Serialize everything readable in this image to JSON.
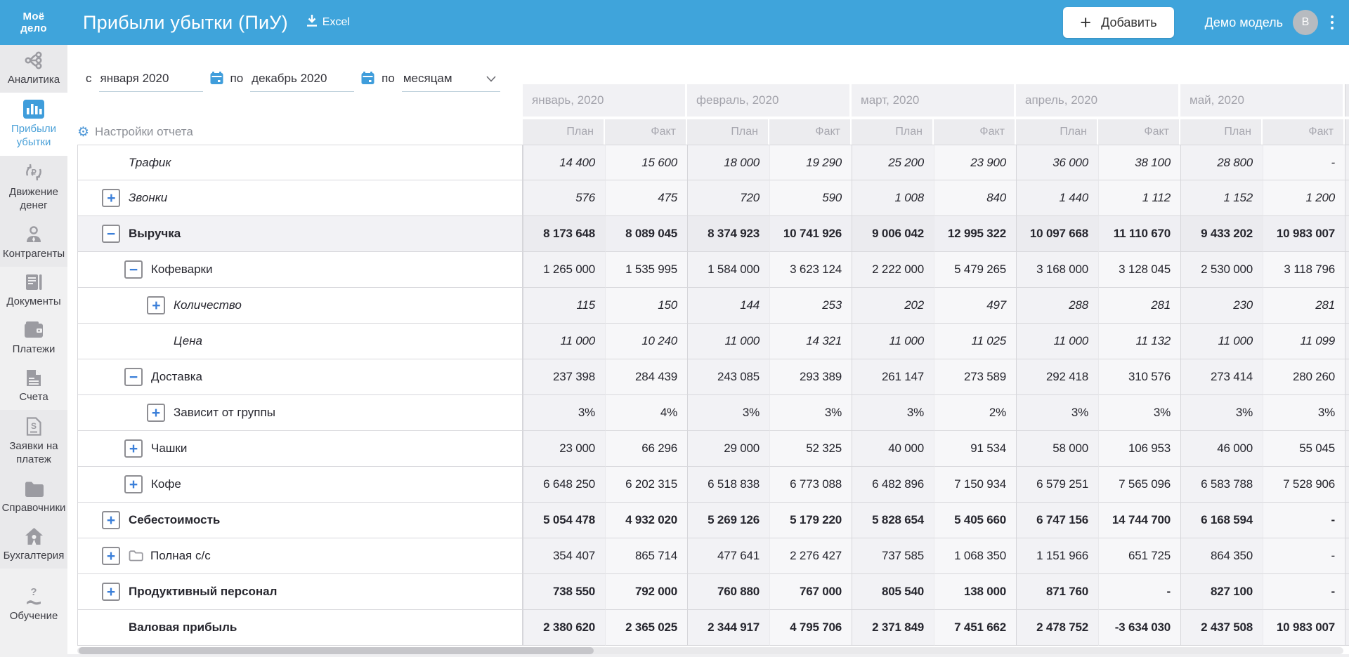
{
  "header": {
    "logo_lines": [
      "Моё",
      "дело"
    ],
    "title": "Прибыли убытки (ПиУ)",
    "excel_label": "Excel",
    "add_button_label": "Добавить",
    "add_plus": "+",
    "account_label": "Демо модель",
    "avatar_letter": "B"
  },
  "colors": {
    "header_blue": "#3fa4db",
    "active_item_blue": "#4ba1d8",
    "toggle_plus_blue": "#3b7fd9",
    "accent_gear_blue": "#4a95d6",
    "avatar_gray": "#b7bbc0"
  },
  "sidebar": {
    "items": [
      {
        "label": "Аналитика",
        "lines": [
          "Аналитика"
        ],
        "icon": "analytics-icon",
        "active": false,
        "tone": "dark"
      },
      {
        "label": "Прибыли убытки",
        "lines": [
          "Прибыли",
          "убытки"
        ],
        "icon": "profit-loss-icon",
        "active": true,
        "tone": "light"
      },
      {
        "label": "Движение денег",
        "lines": [
          "Движение",
          "денег"
        ],
        "icon": "money-flow-icon",
        "active": false,
        "tone": "dark"
      },
      {
        "label": "Контрагенты",
        "lines": [
          "Контрагенты"
        ],
        "icon": "counterparties-icon",
        "active": false,
        "tone": "dark"
      },
      {
        "label": "Документы",
        "lines": [
          "Документы"
        ],
        "icon": "documents-icon",
        "active": false,
        "tone": "light"
      },
      {
        "label": "Платежи",
        "lines": [
          "Платежи"
        ],
        "icon": "payments-icon",
        "active": false,
        "tone": "light"
      },
      {
        "label": "Счета",
        "lines": [
          "Счета"
        ],
        "icon": "invoices-icon",
        "active": false,
        "tone": "light"
      },
      {
        "label": "Заявки на платеж",
        "lines": [
          "Заявки на",
          "платеж"
        ],
        "icon": "payment-request-icon",
        "active": false,
        "tone": "dark"
      },
      {
        "label": "Справочники",
        "lines": [
          "Справочники"
        ],
        "icon": "directories-icon",
        "active": false,
        "tone": "dark"
      },
      {
        "label": "Бухгалтерия",
        "lines": [
          "Бухгалтерия"
        ],
        "icon": "accounting-icon",
        "active": false,
        "tone": "dark"
      },
      {
        "label": "Обучение",
        "lines": [
          "Обучение"
        ],
        "icon": "education-icon",
        "active": false,
        "tone": "light",
        "gap": true
      }
    ]
  },
  "filters": {
    "from_label": "с",
    "from_value": "января 2020",
    "to_label": "по",
    "to_value": "декабрь 2020",
    "period_label": "по",
    "period_value": "месяцам",
    "settings_label": "Настройки отчета"
  },
  "table": {
    "months": [
      "январь, 2020",
      "февраль, 2020",
      "март, 2020",
      "апрель, 2020",
      "май, 2020"
    ],
    "plan_label": "План",
    "fact_label": "Факт",
    "rows": [
      {
        "label": "Трафик",
        "style": "italic",
        "indent": 0,
        "toggle": null,
        "values": [
          "14 400",
          "15 600",
          "18 000",
          "19 290",
          "25 200",
          "23 900",
          "36 000",
          "38 100",
          "28 800",
          "-"
        ]
      },
      {
        "label": "Звонки",
        "style": "italic",
        "indent": 0,
        "toggle": "plus",
        "values": [
          "576",
          "475",
          "720",
          "590",
          "1 008",
          "840",
          "1 440",
          "1 112",
          "1 152",
          "1 200"
        ]
      },
      {
        "label": "Выручка",
        "style": "bold",
        "indent": 0,
        "toggle": "minus",
        "shade": true,
        "values": [
          "8 173 648",
          "8 089 045",
          "8 374 923",
          "10 741 926",
          "9 006 042",
          "12 995 322",
          "10 097 668",
          "11 110 670",
          "9 433 202",
          "10 983 007"
        ]
      },
      {
        "label": "Кофеварки",
        "style": "regular",
        "indent": 1,
        "toggle": "minus",
        "values": [
          "1 265 000",
          "1 535 995",
          "1 584 000",
          "3 623 124",
          "2 222 000",
          "5 479 265",
          "3 168 000",
          "3 128 045",
          "2 530 000",
          "3 118 796"
        ]
      },
      {
        "label": "Количество",
        "style": "italic",
        "indent": 2,
        "toggle": "plus",
        "values": [
          "115",
          "150",
          "144",
          "253",
          "202",
          "497",
          "288",
          "281",
          "230",
          "281"
        ]
      },
      {
        "label": "Цена",
        "style": "italic",
        "indent": 2,
        "toggle": null,
        "values": [
          "11 000",
          "10 240",
          "11 000",
          "14 321",
          "11 000",
          "11 025",
          "11 000",
          "11 132",
          "11 000",
          "11 099"
        ]
      },
      {
        "label": "Доставка",
        "style": "regular",
        "indent": 1,
        "toggle": "minus",
        "values": [
          "237 398",
          "284 439",
          "243 085",
          "293 389",
          "261 147",
          "273 589",
          "292 418",
          "310 576",
          "273 414",
          "280 260"
        ]
      },
      {
        "label": "Зависит от группы",
        "style": "regular",
        "indent": 2,
        "toggle": "plus",
        "values": [
          "3%",
          "4%",
          "3%",
          "3%",
          "3%",
          "2%",
          "3%",
          "3%",
          "3%",
          "3%"
        ]
      },
      {
        "label": "Чашки",
        "style": "regular",
        "indent": 1,
        "toggle": "plus",
        "values": [
          "23 000",
          "66 296",
          "29 000",
          "52 325",
          "40 000",
          "91 534",
          "58 000",
          "106 953",
          "46 000",
          "55 045"
        ]
      },
      {
        "label": "Кофе",
        "style": "regular",
        "indent": 1,
        "toggle": "plus",
        "values": [
          "6 648 250",
          "6 202 315",
          "6 518 838",
          "6 773 088",
          "6 482 896",
          "7 150 934",
          "6 579 251",
          "7 565 096",
          "6 583 788",
          "7 528 906"
        ]
      },
      {
        "label": "Себестоимость",
        "style": "bold",
        "indent": 0,
        "toggle": "plus",
        "values": [
          "5 054 478",
          "4 932 020",
          "5 269 126",
          "5 179 220",
          "5 828 654",
          "5 405 660",
          "6 747 156",
          "14 744 700",
          "6 168 594",
          "-"
        ]
      },
      {
        "label": "Полная с/с",
        "style": "regular",
        "indent": 0,
        "toggle": "plus",
        "folder": true,
        "values": [
          "354 407",
          "865 714",
          "477 641",
          "2 276 427",
          "737 585",
          "1 068 350",
          "1 151 966",
          "651 725",
          "864 350",
          "-"
        ]
      },
      {
        "label": "Продуктивный персонал",
        "style": "bold",
        "indent": 0,
        "toggle": "plus",
        "values": [
          "738 550",
          "792 000",
          "760 880",
          "767 000",
          "805 540",
          "138 000",
          "871 760",
          "-",
          "827 100",
          "-"
        ]
      },
      {
        "label": "Валовая прибыль",
        "style": "bold",
        "indent": 0,
        "toggle": null,
        "values": [
          "2 380 620",
          "2 365 025",
          "2 344 917",
          "4 795 706",
          "2 371 849",
          "7 451 662",
          "2 478 752",
          "-3 634 030",
          "2 437 508",
          "10 983 007"
        ]
      }
    ]
  }
}
